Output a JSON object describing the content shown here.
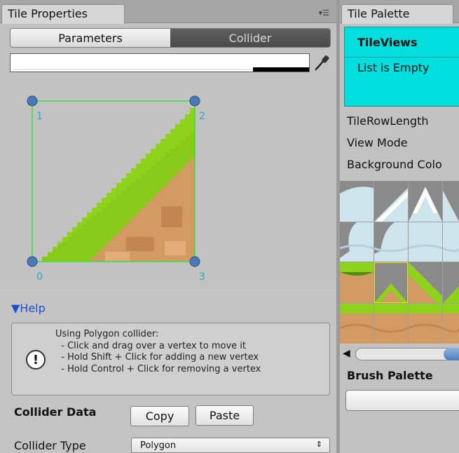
{
  "tile_properties": {
    "tab_label": "Tile Properties",
    "mode_tabs": [
      {
        "label": "Parameters",
        "selected": true
      },
      {
        "label": "Collider",
        "selected": false
      }
    ],
    "vertex_labels": [
      "0",
      "1",
      "2",
      "3"
    ],
    "help": {
      "toggle_label": "▼Help",
      "text": "Using Polygon collider:\n  - Click and drag over a vertex to move it\n  - Hold Shift + Click for adding a new vertex\n  - Hold Control + Click for removing a vertex"
    },
    "collider_data": {
      "label": "Collider Data",
      "copy_label": "Copy",
      "paste_label": "Paste"
    },
    "collider_type": {
      "label": "Collider Type",
      "value": "Polygon"
    }
  },
  "tile_palette": {
    "tab_label": "Tile Palette",
    "tile_views": {
      "title": "TileViews",
      "empty_text": "List is Empty"
    },
    "fields": [
      "TileRowLength",
      "View Mode",
      "Background Colo"
    ],
    "brush_palette_label": "Brush Palette"
  },
  "colors": {
    "accent_cyan": "#00dede",
    "grass_green": "#8ed21c",
    "dirt_brown": "#d49a64",
    "collider_outline": "#3adf3a",
    "vertex_label": "#25a8c0",
    "selection_yellow": "#f0e000",
    "help_link": "#1a4fd1"
  },
  "icons": {
    "tab_menu": "menu-icon",
    "eyedropper": "eyedropper-icon",
    "help": "info-icon",
    "scroll_left": "arrow-left-icon",
    "dropdown": "dropdown-arrows-icon"
  }
}
